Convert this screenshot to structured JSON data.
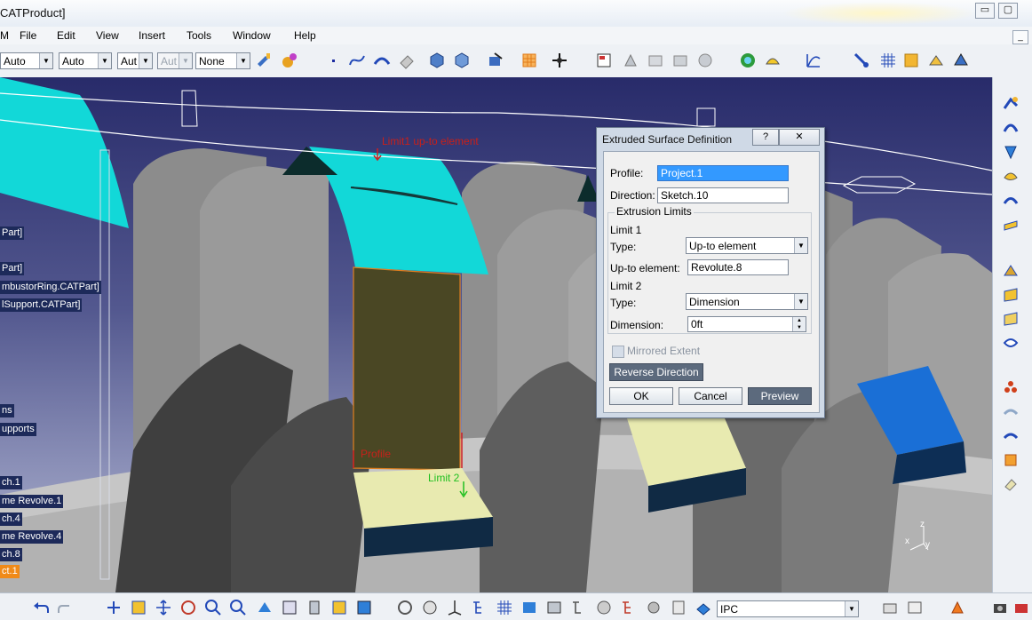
{
  "window": {
    "title": "CATProduct]",
    "min_btn": "▭",
    "max_btn": "▢"
  },
  "menu": [
    "M",
    "File",
    "Edit",
    "View",
    "Insert",
    "Tools",
    "Window",
    "Help"
  ],
  "toolbar": {
    "combo1": "Auto",
    "combo2": "Auto",
    "combo3": "Aut",
    "combo4": "Aut",
    "combo5": "None"
  },
  "tree": [
    {
      "label": "Part]",
      "selected": false
    },
    {
      "label": "Part]",
      "selected": false
    },
    {
      "label": "mbustorRing.CATPart]",
      "selected": false
    },
    {
      "label": "lSupport.CATPart]",
      "selected": false
    },
    {
      "label": "ns",
      "selected": false
    },
    {
      "label": "upports",
      "selected": false
    },
    {
      "label": "ch.1",
      "selected": false
    },
    {
      "label": "me Revolve.1",
      "selected": false
    },
    {
      "label": "ch.4",
      "selected": false
    },
    {
      "label": "me Revolve.4",
      "selected": false
    },
    {
      "label": "ch.8",
      "selected": false
    },
    {
      "label": "ct.1",
      "selected": true
    }
  ],
  "viewport_labels": {
    "limit1": "Limit1 up-to element",
    "profile": "Profile",
    "limit2": "Limit 2",
    "axis_z": "z",
    "axis_x": "x",
    "axis_y": "y"
  },
  "dialog": {
    "title": "Extruded Surface Definition",
    "help_btn": "?",
    "close_btn": "✕",
    "profile_label": "Profile:",
    "profile_value": "Project.1",
    "direction_label": "Direction:",
    "direction_value": "Sketch.10",
    "extrusion_limits": "Extrusion Limits",
    "limit1_label": "Limit 1",
    "type_label": "Type:",
    "limit1_type": "Up-to element",
    "upto_label": "Up-to element:",
    "upto_value": "Revolute.8",
    "limit2_label": "Limit 2",
    "limit2_type": "Dimension",
    "dimension_label": "Dimension:",
    "dimension_value": "0ft",
    "mirrored_extent": "Mirrored Extent",
    "reverse_direction": "Reverse Direction",
    "ok": "OK",
    "cancel": "Cancel",
    "preview": "Preview"
  },
  "bottom": {
    "combo": "IPC"
  },
  "colors": {
    "accent_cyan": "#12d8d8",
    "viewport_top": "#282b6a",
    "selection_orange": "#f08a18",
    "surface_yellow": "#e8eab0",
    "part_blue": "#1a6fd6"
  }
}
